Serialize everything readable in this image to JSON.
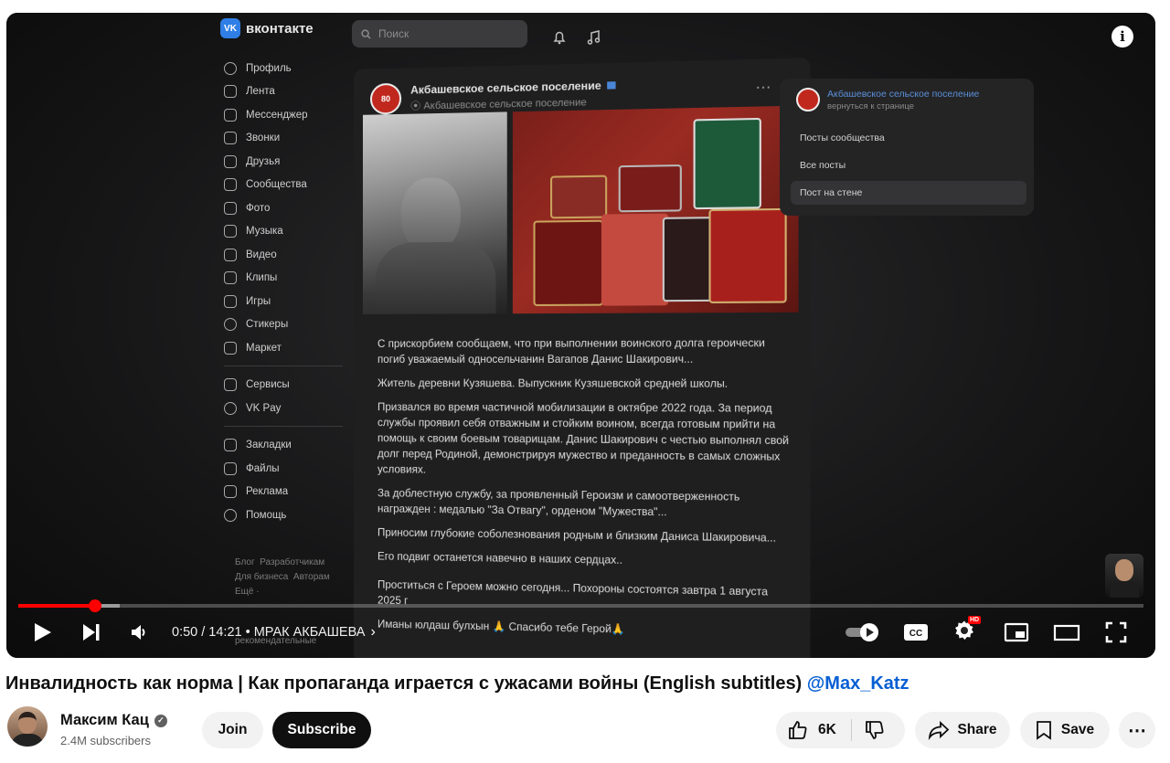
{
  "player": {
    "vk": {
      "logo_text": "VK",
      "brand": "вконтакте",
      "search_placeholder": "Поиск",
      "nav": [
        {
          "label": "Профиль",
          "icon": "user-circle-icon"
        },
        {
          "label": "Лента",
          "icon": "feed-icon"
        },
        {
          "label": "Мессенджер",
          "icon": "chat-bubble-icon"
        },
        {
          "label": "Звонки",
          "icon": "phone-icon"
        },
        {
          "label": "Друзья",
          "icon": "friends-icon"
        },
        {
          "label": "Сообщества",
          "icon": "communities-icon"
        },
        {
          "label": "Фото",
          "icon": "photo-icon"
        },
        {
          "label": "Музыка",
          "icon": "music-icon"
        },
        {
          "label": "Видео",
          "icon": "video-icon"
        },
        {
          "label": "Клипы",
          "icon": "clips-icon"
        },
        {
          "label": "Игры",
          "icon": "gamepad-icon"
        },
        {
          "label": "Стикеры",
          "icon": "sticker-icon"
        },
        {
          "label": "Маркет",
          "icon": "market-bag-icon"
        }
      ],
      "nav2": [
        {
          "label": "Сервисы",
          "icon": "services-icon"
        },
        {
          "label": "VK Pay",
          "icon": "vkpay-icon"
        }
      ],
      "nav3": [
        {
          "label": "Закладки",
          "icon": "bookmark-icon"
        },
        {
          "label": "Файлы",
          "icon": "file-icon"
        },
        {
          "label": "Реклама",
          "icon": "megaphone-icon"
        },
        {
          "label": "Помощь",
          "icon": "help-icon"
        }
      ],
      "footer": {
        "line1a": "Блог",
        "line1b": "Разработчикам",
        "line2a": "Для бизнеса",
        "line2b": "Авторам",
        "line3": "Ещё ·",
        "line4": "рекомендательные"
      },
      "post": {
        "avatar_text": "80",
        "author": "Акбашевское сельское поселение",
        "location": "Акбашевское сельское поселение",
        "paragraphs": [
          "С прискорбием сообщаем, что при выполнении воинского долга героически погиб уважаемый односельчанин Вагапов Данис Шакирович...",
          "Житель деревни Кузяшева. Выпускник Кузяшевской средней школы.",
          "Призвался во время частичной мобилизации в октябре 2022 года. За период службы проявил себя отважным и стойким воином, всегда готовым прийти на помощь к своим боевым товарищам. Данис Шакирович с честью выполнял свой долг перед Родиной, демонстрируя мужество и преданность в самых сложных условиях.",
          "За доблестную службу, за проявленный Героизм и самоотверженность награжден : медалью \"За Отвагу\", орденом \"Мужества\"...",
          "Приносим глубокие соболезнования родным и близким Даниса Шакировича...",
          "Его подвиг останется навечно в наших сердцах..",
          "Проститься с Героем можно сегодня... Похороны состоятся завтра 1 августа 2025 г",
          "Иманы юлдаш булхын 🙏 Спасибо тебе Герой🙏"
        ]
      },
      "side": {
        "title": "Акбашевское сельское поселение",
        "subtitle": "вернуться к странице",
        "items": [
          "Посты сообщества",
          "Все посты",
          "Пост на стене"
        ]
      }
    },
    "controls": {
      "current_time": "0:50",
      "total_time": "14:21",
      "time_text": "0:50 / 14:21",
      "chapter": "• МРАК АКБАШЕВА",
      "hd_badge": "HD",
      "played_fraction": 0.068,
      "buffered_fraction": 0.09
    }
  },
  "video": {
    "title": "Инвалидность как норма | Как пропаганда играется с ужасами войны (English subtitles)",
    "title_link": "@Max_Katz"
  },
  "channel": {
    "name": "Максим Кац",
    "verified_mark": "✓",
    "subscribers": "2.4M subscribers",
    "join_label": "Join",
    "subscribe_label": "Subscribe"
  },
  "actions": {
    "likes": "6K",
    "share_label": "Share",
    "save_label": "Save",
    "more_label": "⋯"
  },
  "colors": {
    "progress_red": "#ff0000",
    "link_blue": "#065fd4",
    "subscribe_bg": "#0f0f0f"
  }
}
